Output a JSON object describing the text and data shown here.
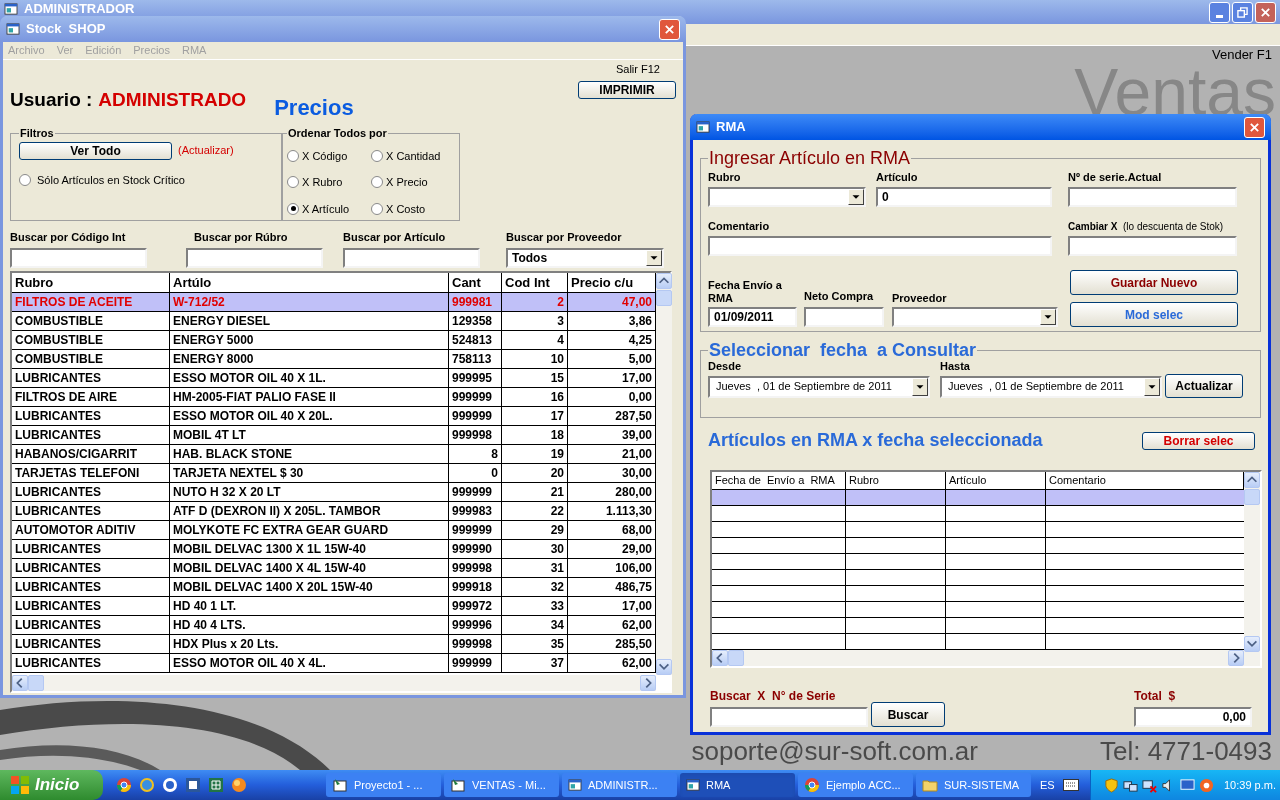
{
  "main_window": {
    "title": "ADMINISTRADOR",
    "shortcut": "Vender F1",
    "watermark": "Ventas",
    "email": "soporte@sur-soft.com.ar",
    "phone": "Tel: 4771-0493"
  },
  "stock_window": {
    "title": "Stock  SHOP",
    "menu": [
      "Archivo",
      "Ver",
      "Edición",
      "Precios",
      "RMA"
    ],
    "exit_hint": "Salir F12",
    "print_button": "IMPRIMIR",
    "user_label": "Usuario :",
    "user_name": "ADMINISTRADO",
    "heading": "Precios",
    "filters": {
      "title": "Filtros",
      "button": "Ver Todo",
      "hint": "(Actualizar)",
      "option": {
        "label": "Sólo Artículos en Stock Crítico",
        "selected": false
      }
    },
    "sort": {
      "title": "Ordenar Todos por",
      "options": [
        {
          "label": "X Código",
          "selected": false
        },
        {
          "label": "X Cantidad",
          "selected": false
        },
        {
          "label": "X Rubro",
          "selected": false
        },
        {
          "label": "X Precio",
          "selected": false
        },
        {
          "label": "X Artículo",
          "selected": true
        },
        {
          "label": "X Costo",
          "selected": false
        }
      ]
    },
    "searches": [
      {
        "label": "Buscar por Código Int",
        "kind": "text"
      },
      {
        "label": "Buscar por Rúbro",
        "kind": "text"
      },
      {
        "label": "Buscar por Artículo",
        "kind": "text"
      },
      {
        "label": "Buscar por Proveedor",
        "kind": "dropdown",
        "value": "Todos"
      }
    ],
    "table": {
      "columns": [
        "Rubro",
        "Artúlo",
        "Cant",
        "Cod Int",
        "Precio c/u"
      ],
      "rows": [
        {
          "cells": [
            "FILTROS DE ACEITE",
            "W-712/52",
            "999981",
            "2",
            "47,00"
          ],
          "selected": true
        },
        {
          "cells": [
            "COMBUSTIBLE",
            "ENERGY DIESEL",
            "129358",
            "3",
            "3,86"
          ],
          "selected": false
        },
        {
          "cells": [
            "COMBUSTIBLE",
            "ENERGY 5000",
            "524813",
            "4",
            "4,25"
          ],
          "selected": false
        },
        {
          "cells": [
            "COMBUSTIBLE",
            "ENERGY 8000",
            "758113",
            "10",
            "5,00"
          ],
          "selected": false
        },
        {
          "cells": [
            "LUBRICANTES",
            "ESSO MOTOR OIL 40 X 1L.",
            "999995",
            "15",
            "17,00"
          ],
          "selected": false
        },
        {
          "cells": [
            "FILTROS DE AIRE",
            "HM-2005-FIAT PALIO FASE II",
            "999999",
            "16",
            "0,00"
          ],
          "selected": false
        },
        {
          "cells": [
            "LUBRICANTES",
            "ESSO MOTOR OIL 40 X 20L.",
            "999999",
            "17",
            "287,50"
          ],
          "selected": false
        },
        {
          "cells": [
            "LUBRICANTES",
            "MOBIL 4T LT",
            "999998",
            "18",
            "39,00"
          ],
          "selected": false
        },
        {
          "cells": [
            "HABANOS/CIGARRIT",
            "HAB. BLACK STONE",
            "8",
            "19",
            "21,00"
          ],
          "selected": false
        },
        {
          "cells": [
            "TARJETAS TELEFONI",
            "TARJETA NEXTEL $ 30",
            "0",
            "20",
            "30,00"
          ],
          "selected": false
        },
        {
          "cells": [
            "LUBRICANTES",
            "NUTO H 32 X 20 LT",
            "999999",
            "21",
            "280,00"
          ],
          "selected": false
        },
        {
          "cells": [
            "LUBRICANTES",
            "ATF D (DEXRON II) X 205L. TAMBOR",
            "999983",
            "22",
            "1.113,30"
          ],
          "selected": false
        },
        {
          "cells": [
            "AUTOMOTOR ADITIV",
            "MOLYKOTE FC EXTRA GEAR GUARD",
            "999999",
            "29",
            "68,00"
          ],
          "selected": false
        },
        {
          "cells": [
            "LUBRICANTES",
            "MOBIL DELVAC 1300 X 1L 15W-40",
            "999990",
            "30",
            "29,00"
          ],
          "selected": false
        },
        {
          "cells": [
            "LUBRICANTES",
            "MOBIL DELVAC 1400 X 4L 15W-40",
            "999998",
            "31",
            "106,00"
          ],
          "selected": false
        },
        {
          "cells": [
            "LUBRICANTES",
            "MOBIL DELVAC 1400 X 20L 15W-40",
            "999918",
            "32",
            "486,75"
          ],
          "selected": false
        },
        {
          "cells": [
            "LUBRICANTES",
            "HD 40 1 LT.",
            "999972",
            "33",
            "17,00"
          ],
          "selected": false
        },
        {
          "cells": [
            "LUBRICANTES",
            "HD 40 4 LTS.",
            "999996",
            "34",
            "62,00"
          ],
          "selected": false
        },
        {
          "cells": [
            "LUBRICANTES",
            "HDX Plus x 20 Lts.",
            "999998",
            "35",
            "285,50"
          ],
          "selected": false
        },
        {
          "cells": [
            "LUBRICANTES",
            "ESSO MOTOR OIL 40 X 4L.",
            "999999",
            "37",
            "62,00"
          ],
          "selected": false
        }
      ]
    }
  },
  "rma_window": {
    "title": "RMA",
    "entry": {
      "title": "Ingresar Artículo  en RMA",
      "rubro": {
        "label": "Rubro",
        "kind": "dropdown"
      },
      "articulo": {
        "label": "Artículo",
        "kind": "text",
        "value": "0"
      },
      "serial": {
        "label": "Nº de serie.Actual",
        "kind": "text"
      },
      "comment": {
        "label": "Comentario",
        "kind": "text"
      },
      "swap": {
        "label": "**Cambiar X**  (lo descuenta de Stok)",
        "kind": "text"
      },
      "date": {
        "label": "Fecha Envío a RMA",
        "kind": "text",
        "value": "01/09/2011"
      },
      "cost": {
        "label": "Neto Compra",
        "kind": "text"
      },
      "supplier": {
        "label": "Proveedor",
        "kind": "dropdown"
      },
      "save_button": "Guardar Nuevo",
      "modify_button": "Mod selec"
    },
    "query": {
      "title": "Seleccionar  fecha  a Consultar",
      "from": {
        "label": "Desde",
        "value": "Jueves  , 01 de Septiembre de 2011"
      },
      "to": {
        "label": "Hasta",
        "value": "Jueves  , 01 de Septiembre de 2011"
      },
      "button": "Actualizar"
    },
    "list_title": "Artículos en RMA x fecha seleccionada",
    "delete_button": "Borrar selec",
    "grid": {
      "columns": [
        "Fecha de  Envío a  RMA",
        "Rubro",
        "Artículo",
        "Comentario"
      ],
      "rows": [
        {
          "selected": true
        },
        {
          "selected": false
        },
        {
          "selected": false
        },
        {
          "selected": false
        },
        {
          "selected": false
        },
        {
          "selected": false
        },
        {
          "selected": false
        },
        {
          "selected": false
        },
        {
          "selected": false
        },
        {
          "selected": false
        }
      ]
    },
    "serial_search": {
      "label": "Buscar  X  N° de Serie",
      "button": "Buscar"
    },
    "total": {
      "label": "Total  $",
      "value": "0,00"
    }
  },
  "taskbar": {
    "start": "Inicio",
    "tasks": [
      {
        "label": "Proyecto1 - ...",
        "kind": "project",
        "selected": false
      },
      {
        "label": "VENTAS - Mi...",
        "kind": "project",
        "selected": false
      },
      {
        "label": "ADMINISTR...",
        "kind": "form",
        "selected": false
      },
      {
        "label": "RMA",
        "kind": "form",
        "selected": true
      },
      {
        "label": "Ejemplo ACC...",
        "kind": "browser",
        "selected": false
      },
      {
        "label": "SUR-SISTEMA",
        "kind": "folder",
        "selected": false
      }
    ],
    "language": "ES",
    "clock": "10:39 p.m."
  }
}
